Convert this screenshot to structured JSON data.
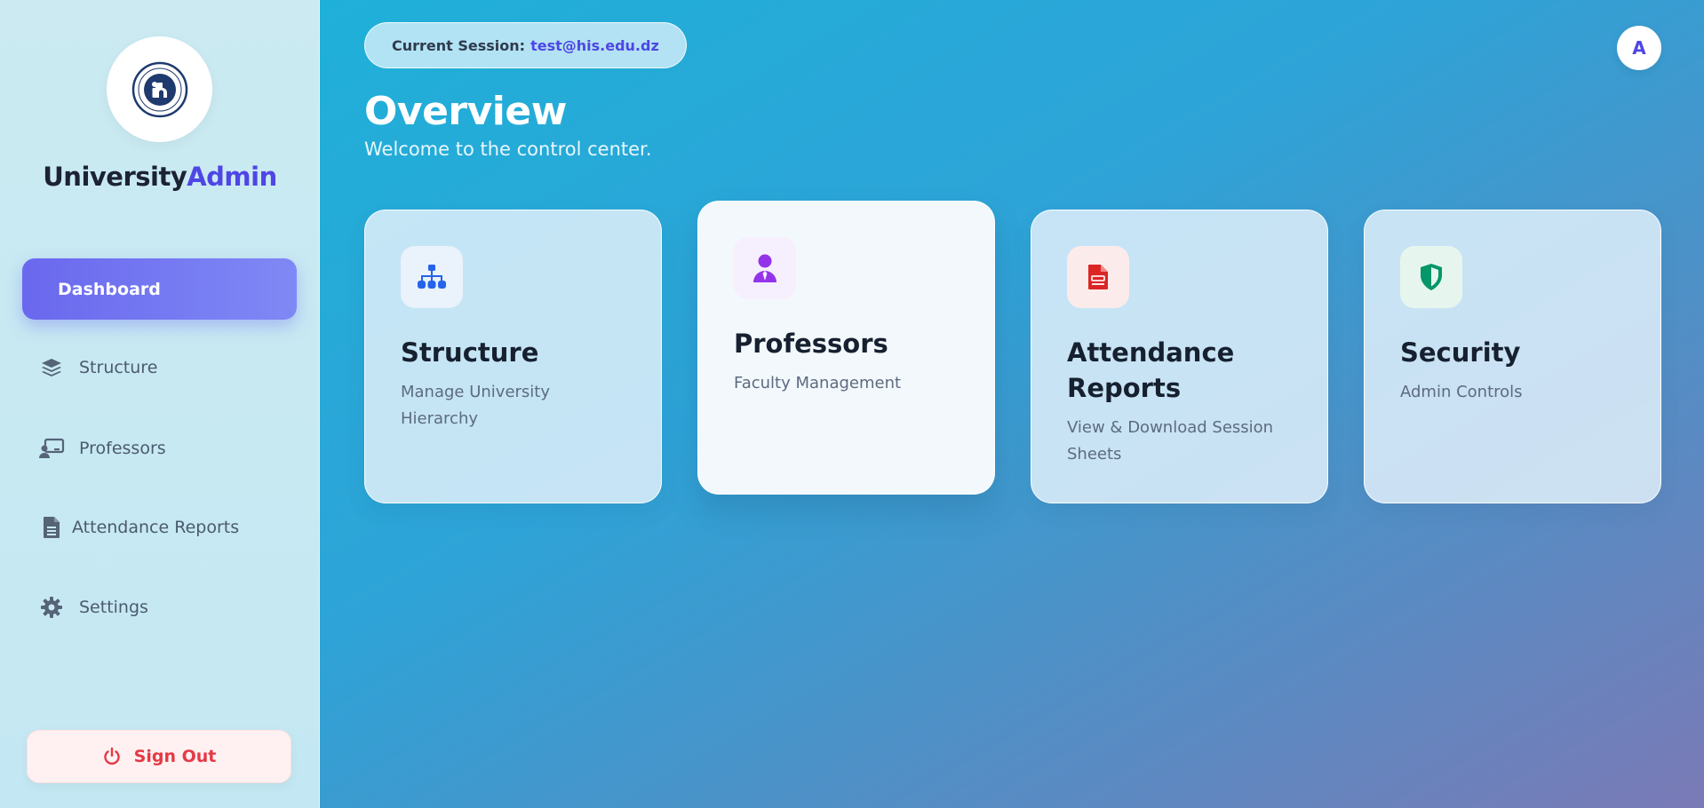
{
  "brand": {
    "part1": "University",
    "part2": "Admin"
  },
  "sidebar": {
    "items": [
      {
        "label": "Dashboard",
        "icon": "none"
      },
      {
        "label": "Structure",
        "icon": "layers-icon"
      },
      {
        "label": "Professors",
        "icon": "chalkboard-user-icon"
      },
      {
        "label": "Attendance Reports",
        "icon": "file-lines-icon"
      },
      {
        "label": "Settings",
        "icon": "gear-icon"
      }
    ],
    "signout_label": "Sign Out"
  },
  "header": {
    "session_label": "Current Session:",
    "session_email": "test@his.edu.dz",
    "avatar_initial": "A"
  },
  "page": {
    "title": "Overview",
    "subtitle": "Welcome to the control center."
  },
  "cards": [
    {
      "title": "Structure",
      "desc": "Manage University Hierarchy",
      "icon": "sitemap-icon",
      "accent": "#2563eb"
    },
    {
      "title": "Professors",
      "desc": "Faculty Management",
      "icon": "user-tie-icon",
      "accent": "#9333ea"
    },
    {
      "title": "Attendance Reports",
      "desc": "View & Download Session Sheets",
      "icon": "file-report-icon",
      "accent": "#dc2626"
    },
    {
      "title": "Security",
      "desc": "Admin Controls",
      "icon": "shield-icon",
      "accent": "#059669"
    }
  ],
  "colors": {
    "accent": "#4f46e5",
    "active_nav": "#6a68ee",
    "signout": "#e53945"
  }
}
